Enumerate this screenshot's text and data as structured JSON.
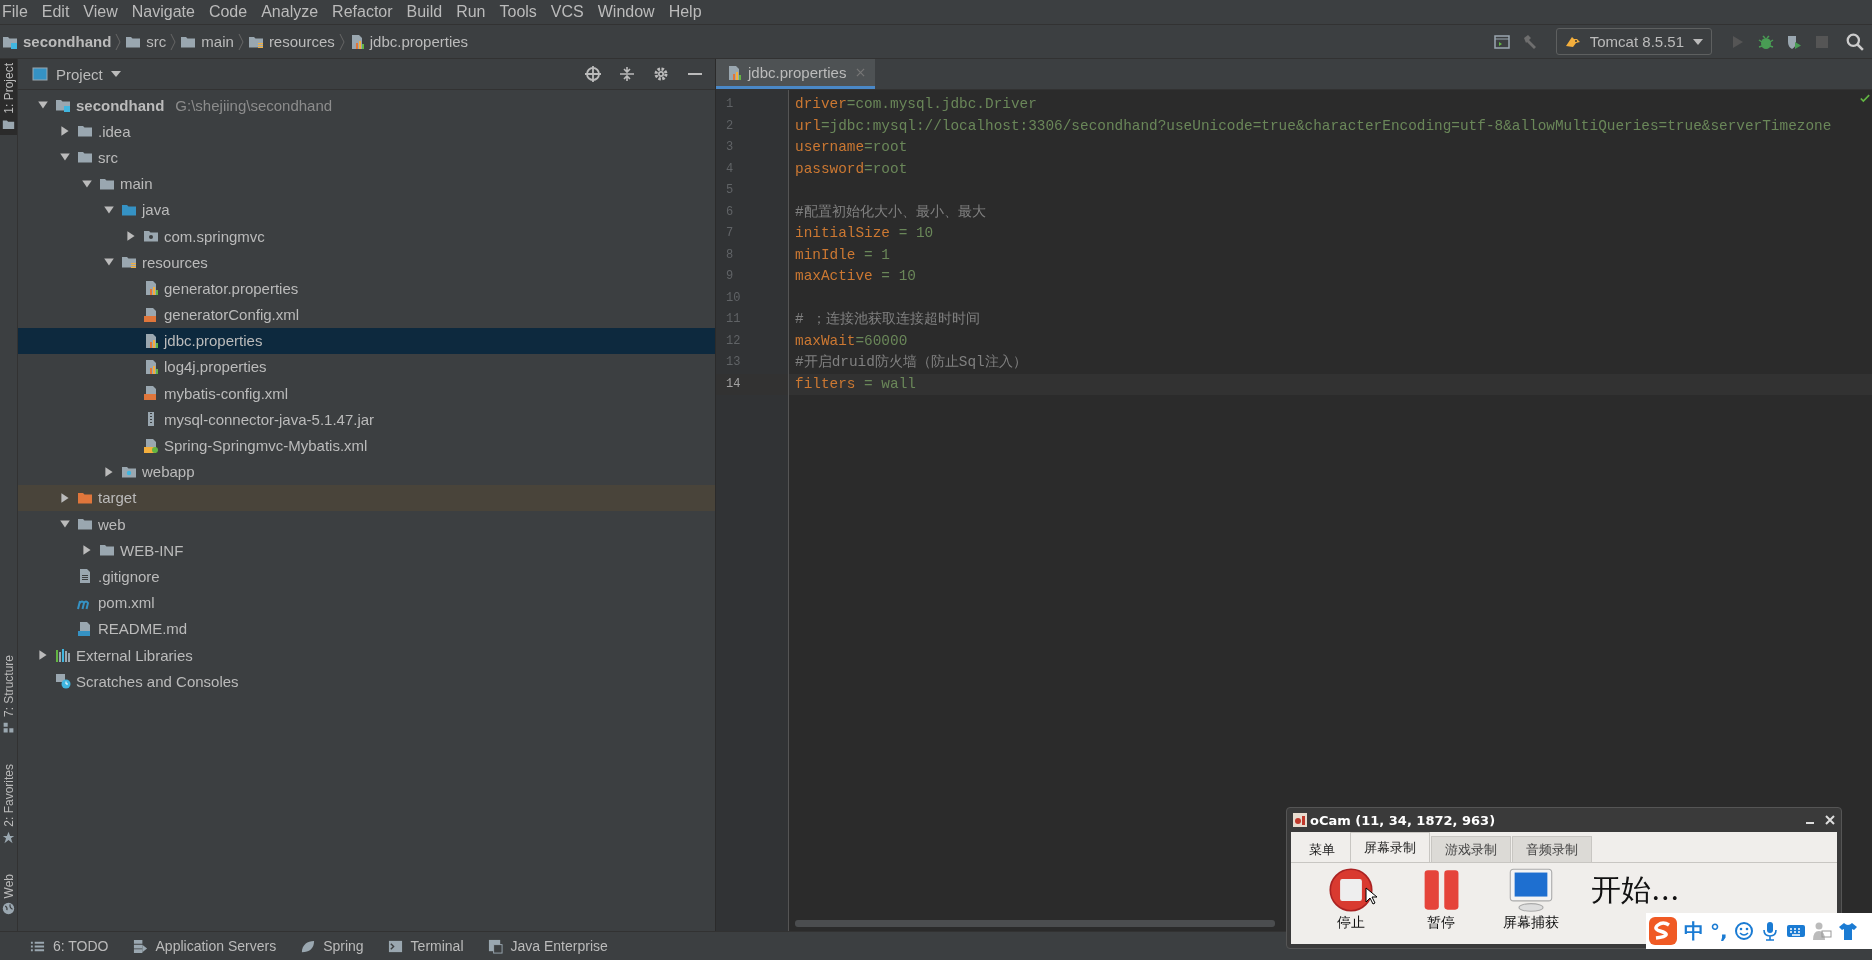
{
  "menu": [
    "File",
    "Edit",
    "View",
    "Navigate",
    "Code",
    "Analyze",
    "Refactor",
    "Build",
    "Run",
    "Tools",
    "VCS",
    "Window",
    "Help"
  ],
  "breadcrumbs": [
    {
      "label": "secondhand",
      "kind": "module"
    },
    {
      "label": "src",
      "kind": "folder"
    },
    {
      "label": "main",
      "kind": "folder"
    },
    {
      "label": "resources",
      "kind": "resources"
    },
    {
      "label": "jdbc.properties",
      "kind": "properties"
    }
  ],
  "run_config": {
    "label": "Tomcat 8.5.51"
  },
  "tool_strip": [
    {
      "label": "1: Project",
      "kind": "folder",
      "selected": true
    },
    {
      "label": "7: Structure",
      "kind": "structure",
      "selected": false
    },
    {
      "label": "2: Favorites",
      "kind": "star",
      "selected": false
    },
    {
      "label": "Web",
      "kind": "globe",
      "selected": false
    }
  ],
  "project_panel": {
    "title": "Project",
    "tree": [
      {
        "label": "secondhand",
        "path": "G:\\shejiing\\secondhand",
        "kind": "module",
        "expanded": true,
        "selected": false,
        "children": [
          {
            "label": ".idea",
            "kind": "folder",
            "expanded": false,
            "selected": false
          },
          {
            "label": "src",
            "kind": "folder",
            "expanded": true,
            "selected": false,
            "children": [
              {
                "label": "main",
                "kind": "folder",
                "expanded": true,
                "selected": false,
                "children": [
                  {
                    "label": "java",
                    "kind": "source",
                    "expanded": true,
                    "selected": false,
                    "children": [
                      {
                        "label": "com.springmvc",
                        "kind": "package",
                        "expanded": false,
                        "selected": false
                      }
                    ]
                  },
                  {
                    "label": "resources",
                    "kind": "resources",
                    "expanded": true,
                    "selected": false,
                    "children": [
                      {
                        "label": "generator.properties",
                        "kind": "properties",
                        "selected": false
                      },
                      {
                        "label": "generatorConfig.xml",
                        "kind": "xml",
                        "selected": false
                      },
                      {
                        "label": "jdbc.properties",
                        "kind": "properties",
                        "selected": true
                      },
                      {
                        "label": "log4j.properties",
                        "kind": "properties",
                        "selected": false
                      },
                      {
                        "label": "mybatis-config.xml",
                        "kind": "xml",
                        "selected": false
                      },
                      {
                        "label": "mysql-connector-java-5.1.47.jar",
                        "kind": "jar",
                        "selected": false
                      },
                      {
                        "label": "Spring-Springmvc-Mybatis.xml",
                        "kind": "spring",
                        "selected": false
                      }
                    ]
                  },
                  {
                    "label": "webapp",
                    "kind": "web",
                    "expanded": false,
                    "selected": false
                  }
                ]
              }
            ]
          },
          {
            "label": "target",
            "kind": "excluded",
            "expanded": false,
            "selected": false,
            "excluded": true
          },
          {
            "label": "web",
            "kind": "folder",
            "expanded": true,
            "selected": false,
            "children": [
              {
                "label": "WEB-INF",
                "kind": "folder",
                "expanded": false,
                "selected": false
              }
            ]
          },
          {
            "label": ".gitignore",
            "kind": "text",
            "selected": false
          },
          {
            "label": "pom.xml",
            "kind": "maven",
            "selected": false
          },
          {
            "label": "README.md",
            "kind": "md",
            "selected": false
          }
        ]
      },
      {
        "label": "External Libraries",
        "kind": "libraries",
        "expanded": false,
        "selected": false
      },
      {
        "label": "Scratches and Consoles",
        "kind": "scratches",
        "selected": false
      }
    ]
  },
  "editor": {
    "tabs": [
      {
        "label": "jdbc.properties",
        "kind": "properties",
        "selected": true
      }
    ],
    "lines": [
      {
        "number": "1",
        "kind": "pair",
        "key": "driver",
        "value": "=com.mysql.jdbc.Driver",
        "current": false
      },
      {
        "number": "2",
        "kind": "pair",
        "key": "url",
        "value": "=jdbc:mysql://localhost:3306/secondhand?useUnicode=true&characterEncoding=utf-8&allowMultiQueries=true&serverTimezone",
        "current": false
      },
      {
        "number": "3",
        "kind": "pair",
        "key": "username",
        "value": "=root",
        "current": false
      },
      {
        "number": "4",
        "kind": "pair",
        "key": "password",
        "value": "=root",
        "current": false
      },
      {
        "number": "5",
        "kind": "blank",
        "current": false
      },
      {
        "number": "6",
        "kind": "comment",
        "text": "#配置初始化大小、最小、最大",
        "current": false
      },
      {
        "number": "7",
        "kind": "pair",
        "key": "initialSize",
        "value": " = 10",
        "current": false
      },
      {
        "number": "8",
        "kind": "pair",
        "key": "minIdle",
        "value": " = 1",
        "current": false
      },
      {
        "number": "9",
        "kind": "pair",
        "key": "maxActive",
        "value": " = 10",
        "current": false
      },
      {
        "number": "10",
        "kind": "blank",
        "current": false
      },
      {
        "number": "11",
        "kind": "comment",
        "text": "# ；连接池获取连接超时时间",
        "current": false
      },
      {
        "number": "12",
        "kind": "pair",
        "key": "maxWait",
        "value": "=60000",
        "current": false
      },
      {
        "number": "13",
        "kind": "comment",
        "text": "#开启druid防火墙（防止Sql注入）",
        "current": false
      },
      {
        "number": "14",
        "kind": "pair",
        "key": "filters",
        "value": " = wall",
        "current": true
      }
    ]
  },
  "bottom_tools": [
    {
      "label": "6: TODO",
      "kind": "list"
    },
    {
      "label": "Application Servers",
      "kind": "servers"
    },
    {
      "label": "Spring",
      "kind": "leaf"
    },
    {
      "label": "Terminal",
      "kind": "terminal"
    },
    {
      "label": "Java Enterprise",
      "kind": "javaee"
    }
  ],
  "ocam": {
    "title": "oCam (11, 34, 1872, 963)",
    "tabs": [
      {
        "label": "菜单",
        "selected": false
      },
      {
        "label": "屏幕录制",
        "selected": true
      },
      {
        "label": "游戏录制",
        "selected": false
      },
      {
        "label": "音频录制",
        "selected": false
      }
    ],
    "actions": [
      {
        "label": "停止",
        "kind": "stop"
      },
      {
        "label": "暂停",
        "kind": "pause"
      },
      {
        "label": "屏幕捕获",
        "kind": "monitor"
      }
    ],
    "status": "开始..."
  },
  "ime": {
    "mode": "中",
    "punctuation": "°,"
  }
}
